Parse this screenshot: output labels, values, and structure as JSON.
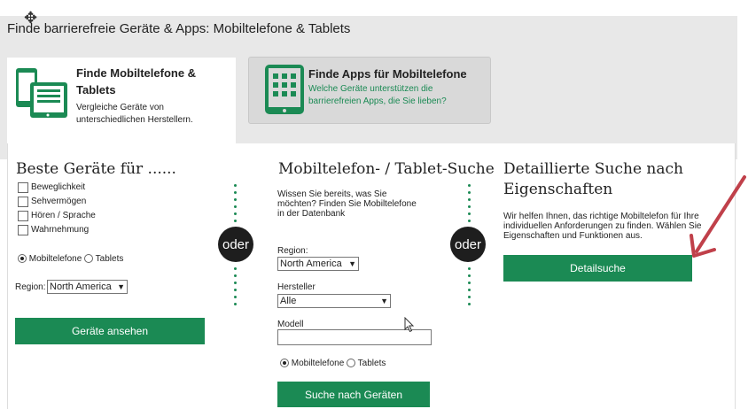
{
  "header": {
    "title": "Finde barrierefreie Geräte & Apps: Mobiltelefone & Tablets"
  },
  "colors": {
    "accent": "#1b8a54",
    "arrow": "#c0404a",
    "tab_inactive_bg": "#d9d9d9"
  },
  "tabs": [
    {
      "title": "Finde Mobiltelefone & Tablets",
      "subtitle": "Vergleiche Geräte von unterschiedlichen Herstellern.",
      "icon": "phone-tablet-icon"
    },
    {
      "title": "Finde Apps für Mobiltelefone",
      "subtitle": "Welche Geräte unterstützen die barrierefreien Apps, die Sie lieben?",
      "icon": "app-grid-icon"
    }
  ],
  "left": {
    "title": "Beste Geräte für ......",
    "checkboxes": [
      "Beweglichkeit",
      "Sehvermögen",
      "Hören / Sprache",
      "Wahrnehmung"
    ],
    "radio": {
      "option1": "Mobiltelefone",
      "option2": "Tablets"
    },
    "region_label": "Region:",
    "region_value": "North America",
    "button": "Geräte ansehen"
  },
  "divider": {
    "label": "oder"
  },
  "middle": {
    "title": "Mobiltelefon- / Tablet-Suche",
    "intro": "Wissen Sie bereits, was Sie möchten? Finden Sie Mobiltelefone in der Datenbank",
    "region_label": "Region:",
    "region_value": "North America",
    "manufacturer_label": "Hersteller",
    "manufacturer_value": "Alle",
    "model_label": "Modell",
    "radio": {
      "option1": "Mobiltelefone",
      "option2": "Tablets"
    },
    "button": "Suche nach Geräten"
  },
  "right": {
    "title_line1": "Detaillierte Suche nach",
    "title_line2": "Eigenschaften",
    "description": "Wir helfen Ihnen, das richtige Mobiltelefon für Ihre individuellen Anforderungen zu finden. Wählen Sie Eigenschaften und Funktionen aus.",
    "button": "Detailsuche"
  }
}
